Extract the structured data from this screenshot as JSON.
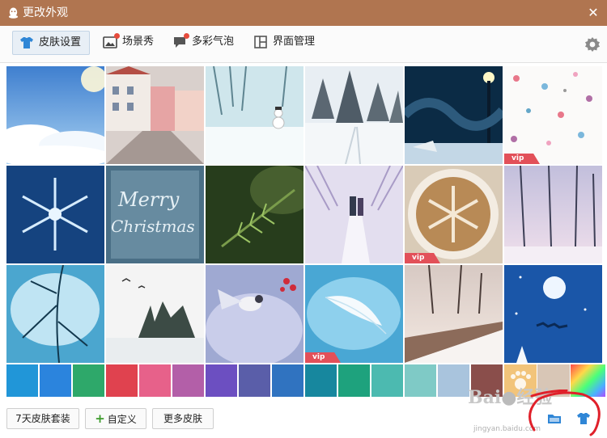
{
  "window": {
    "title": "更改外观",
    "close_glyph": "✕"
  },
  "tabs": [
    {
      "label": "皮肤设置",
      "icon": "tshirt-icon",
      "active": true
    },
    {
      "label": "场景秀",
      "icon": "picture-icon",
      "badge": true
    },
    {
      "label": "多彩气泡",
      "icon": "speech-bubble-icon",
      "badge": true
    },
    {
      "label": "界面管理",
      "icon": "layout-icon"
    }
  ],
  "skins": {
    "vip_label": "vip",
    "items": [
      {
        "name": "sky-clouds",
        "vip": false
      },
      {
        "name": "snowy-street",
        "vip": false
      },
      {
        "name": "snowman",
        "vip": false
      },
      {
        "name": "snowy-forest",
        "vip": false
      },
      {
        "name": "night-lamp",
        "vip": false
      },
      {
        "name": "flower-pattern",
        "vip": true
      },
      {
        "name": "snowflake-blue",
        "vip": false
      },
      {
        "name": "merry-christmas",
        "vip": false
      },
      {
        "name": "pine-branch",
        "vip": false
      },
      {
        "name": "couple-walk",
        "vip": false
      },
      {
        "name": "latte-snowflake",
        "vip": true
      },
      {
        "name": "winter-trees",
        "vip": false
      },
      {
        "name": "icy-branch",
        "vip": false
      },
      {
        "name": "lake-birds",
        "vip": false
      },
      {
        "name": "bird-berries",
        "vip": false
      },
      {
        "name": "white-feather",
        "vip": true
      },
      {
        "name": "snow-bridge",
        "vip": false
      },
      {
        "name": "moon-reindeer",
        "vip": false
      }
    ]
  },
  "colors": [
    "#2196d8",
    "#2b84dd",
    "#2ea86a",
    "#e0424f",
    "#e7618a",
    "#b35fa8",
    "#6c4fc1",
    "#5a5ea9",
    "#3073c0",
    "#17879e",
    "#1ea27d",
    "#4cbab0",
    "#7fcac6",
    "#a9c4dd",
    "#8a4e4b"
  ],
  "bottom": {
    "suite_label": "7天皮肤套装",
    "custom_label": "自定义",
    "more_label": "更多皮肤"
  },
  "watermark": {
    "text": "Bai",
    "text2": "经验",
    "url": "jingyan.baidu.com"
  }
}
